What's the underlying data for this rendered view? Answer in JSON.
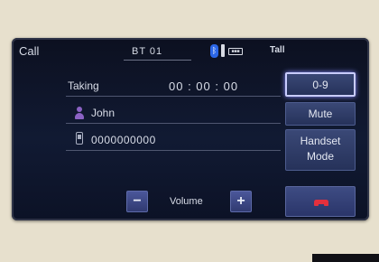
{
  "header": {
    "title": "Call",
    "device_name": "BT 01",
    "signal_text": "Tall"
  },
  "call": {
    "status": "Taking",
    "timer": "00 : 00 : 00",
    "contact_name": "John",
    "phone_number": "0000000000"
  },
  "buttons": {
    "keypad": "0-9",
    "mute": "Mute",
    "handset_line1": "Handset",
    "handset_line2": "Mode",
    "volume_label": "Volume",
    "minus": "−",
    "plus": "+"
  },
  "icons": {
    "bluetooth": "bluetooth-icon",
    "battery": "battery-icon",
    "signal": "signal-icon",
    "contact": "person-icon",
    "phone": "mobile-phone-icon",
    "end_call": "end-call-icon"
  },
  "colors": {
    "accent_purple": "#8b62c4",
    "end_call_red": "#e4303d",
    "bluetooth_blue": "#2b66e6"
  }
}
